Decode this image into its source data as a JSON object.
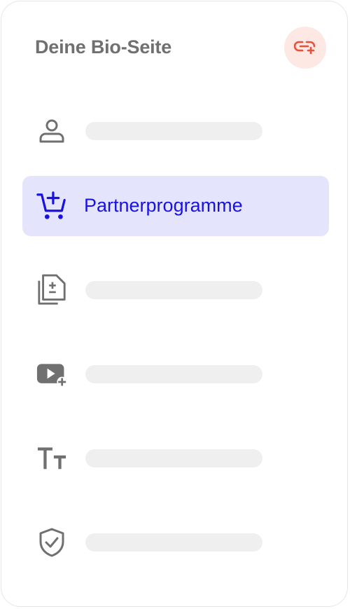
{
  "header": {
    "title": "Deine Bio-Seite",
    "add_button_icon": "link-plus-icon"
  },
  "menu": [
    {
      "icon": "user-icon",
      "label": null,
      "active": false
    },
    {
      "icon": "cart-plus-icon",
      "label": "Partnerprogramme",
      "active": true
    },
    {
      "icon": "documents-plus-minus-icon",
      "label": null,
      "active": false
    },
    {
      "icon": "video-plus-icon",
      "label": null,
      "active": false
    },
    {
      "icon": "text-size-icon",
      "label": null,
      "active": false
    },
    {
      "icon": "shield-check-icon",
      "label": null,
      "active": false
    }
  ],
  "colors": {
    "accent": "#1a12e0",
    "active_bg": "#e4e5fd",
    "icon_gray": "#707070",
    "button_bg": "#fde8e3",
    "button_icon": "#e8503a",
    "placeholder": "#efefef"
  }
}
